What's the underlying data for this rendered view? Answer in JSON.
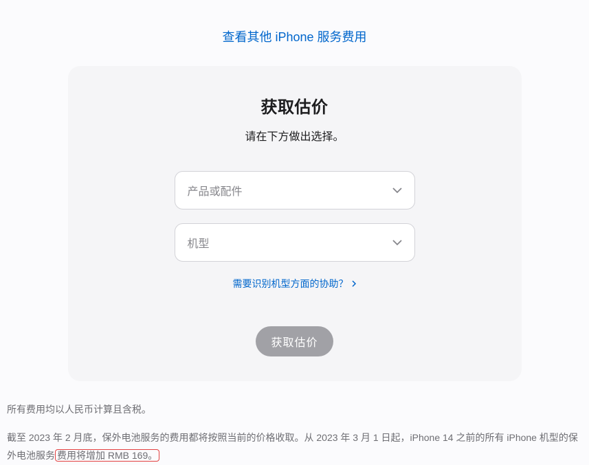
{
  "topLink": {
    "label": "查看其他 iPhone 服务费用"
  },
  "card": {
    "title": "获取估价",
    "subtitle": "请在下方做出选择。",
    "select1": {
      "placeholder": "产品或配件"
    },
    "select2": {
      "placeholder": "机型"
    },
    "helpLink": "需要识别机型方面的协助？",
    "submit": "获取估价"
  },
  "footnotes": {
    "line1": "所有费用均以人民币计算且含税。",
    "line2_part1": "截至 2023 年 2 月底，保外电池服务的费用都将按照当前的价格收取。从 2023 年 3 月 1 日起，iPhone 14 之前的所有 iPhone 机型的保外电池服",
    "line2_lead": "务",
    "line2_highlight": "费用将增加 RMB 169。"
  }
}
